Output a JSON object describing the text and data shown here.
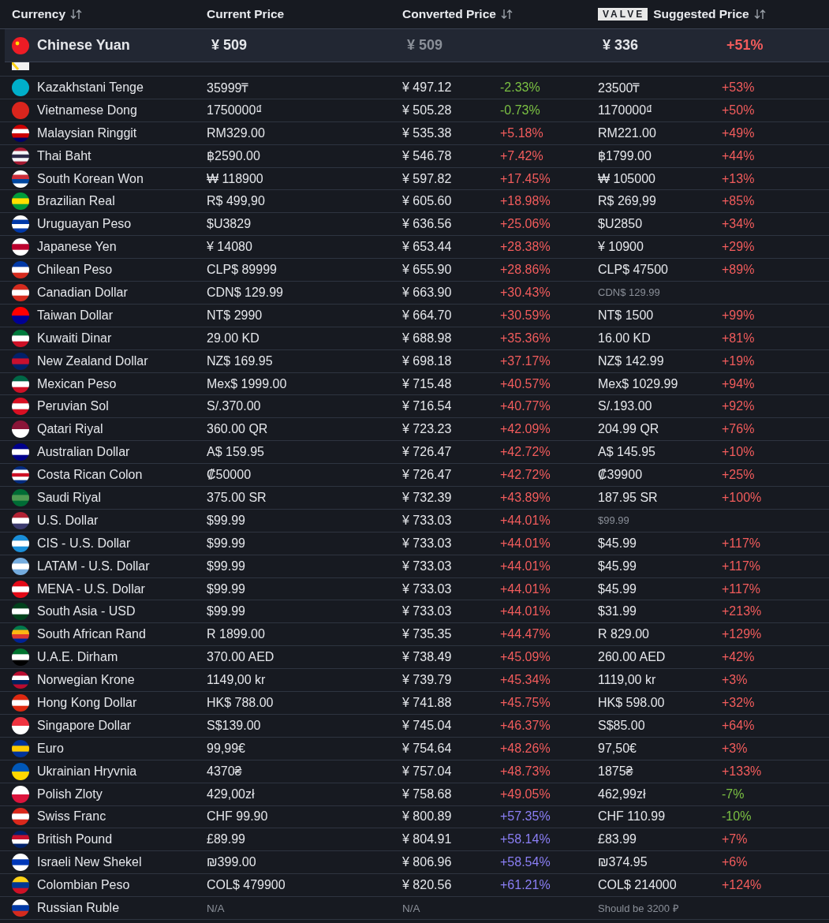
{
  "columns": [
    {
      "label": "Currency",
      "sortable": true
    },
    {
      "label": "Current Price",
      "sortable": false
    },
    {
      "label": "Converted Price",
      "sortable": true
    },
    {
      "label": "Suggested Price",
      "sortable": true,
      "badge": "VALVE"
    }
  ],
  "pinned": {
    "currency": "Chinese Yuan",
    "current": "¥ 509",
    "converted": "¥ 509",
    "suggested": "¥ 336",
    "sdiff": {
      "text": "+51%",
      "color": "#f25c5c"
    }
  },
  "rows": [
    {
      "currency": "Kazakhstani Tenge",
      "current": "35999₸",
      "converted": "¥ 497.12",
      "diff": {
        "text": "-2.33%",
        "color": "#7bc043"
      },
      "suggested": "23500₸",
      "sdiff": {
        "text": "+53%",
        "color": "#f25c5c"
      },
      "unavailable": false,
      "suggested_muted": false
    },
    {
      "currency": "Vietnamese Dong",
      "current": "1750000₫",
      "converted": "¥ 505.28",
      "diff": {
        "text": "-0.73%",
        "color": "#7bc043"
      },
      "suggested": "1170000₫",
      "sdiff": {
        "text": "+50%",
        "color": "#f25c5c"
      },
      "unavailable": false,
      "suggested_muted": false
    },
    {
      "currency": "Malaysian Ringgit",
      "current": "RM329.00",
      "converted": "¥ 535.38",
      "diff": {
        "text": "+5.18%",
        "color": "#f25c5c"
      },
      "suggested": "RM221.00",
      "sdiff": {
        "text": "+49%",
        "color": "#f25c5c"
      },
      "unavailable": false,
      "suggested_muted": false
    },
    {
      "currency": "Thai Baht",
      "current": "฿2590.00",
      "converted": "¥ 546.78",
      "diff": {
        "text": "+7.42%",
        "color": "#f25c5c"
      },
      "suggested": "฿1799.00",
      "sdiff": {
        "text": "+44%",
        "color": "#f25c5c"
      },
      "unavailable": false,
      "suggested_muted": false
    },
    {
      "currency": "South Korean Won",
      "current": "₩ 118900",
      "converted": "¥ 597.82",
      "diff": {
        "text": "+17.45%",
        "color": "#f25c5c"
      },
      "suggested": "₩ 105000",
      "sdiff": {
        "text": "+13%",
        "color": "#f25c5c"
      },
      "unavailable": false,
      "suggested_muted": false
    },
    {
      "currency": "Brazilian Real",
      "current": "R$ 499,90",
      "converted": "¥ 605.60",
      "diff": {
        "text": "+18.98%",
        "color": "#f25c5c"
      },
      "suggested": "R$ 269,99",
      "sdiff": {
        "text": "+85%",
        "color": "#f25c5c"
      },
      "unavailable": false,
      "suggested_muted": false
    },
    {
      "currency": "Uruguayan Peso",
      "current": "$U3829",
      "converted": "¥ 636.56",
      "diff": {
        "text": "+25.06%",
        "color": "#f25c5c"
      },
      "suggested": "$U2850",
      "sdiff": {
        "text": "+34%",
        "color": "#f25c5c"
      },
      "unavailable": false,
      "suggested_muted": false
    },
    {
      "currency": "Japanese Yen",
      "current": "¥ 14080",
      "converted": "¥ 653.44",
      "diff": {
        "text": "+28.38%",
        "color": "#f25c5c"
      },
      "suggested": "¥ 10900",
      "sdiff": {
        "text": "+29%",
        "color": "#f25c5c"
      },
      "unavailable": false,
      "suggested_muted": false
    },
    {
      "currency": "Chilean Peso",
      "current": "CLP$ 89999",
      "converted": "¥ 655.90",
      "diff": {
        "text": "+28.86%",
        "color": "#f25c5c"
      },
      "suggested": "CLP$ 47500",
      "sdiff": {
        "text": "+89%",
        "color": "#f25c5c"
      },
      "unavailable": false,
      "suggested_muted": false
    },
    {
      "currency": "Canadian Dollar",
      "current": "CDN$ 129.99",
      "converted": "¥ 663.90",
      "diff": {
        "text": "+30.43%",
        "color": "#f25c5c"
      },
      "suggested": "CDN$ 129.99",
      "unavailable": false,
      "suggested_muted": true
    },
    {
      "currency": "Taiwan Dollar",
      "current": "NT$ 2990",
      "converted": "¥ 664.70",
      "diff": {
        "text": "+30.59%",
        "color": "#f25c5c"
      },
      "suggested": "NT$ 1500",
      "sdiff": {
        "text": "+99%",
        "color": "#f25c5c"
      },
      "unavailable": false,
      "suggested_muted": false
    },
    {
      "currency": "Kuwaiti Dinar",
      "current": "29.00 KD",
      "converted": "¥ 688.98",
      "diff": {
        "text": "+35.36%",
        "color": "#f25c5c"
      },
      "suggested": "16.00 KD",
      "sdiff": {
        "text": "+81%",
        "color": "#f25c5c"
      },
      "unavailable": false,
      "suggested_muted": false
    },
    {
      "currency": "New Zealand Dollar",
      "current": "NZ$ 169.95",
      "converted": "¥ 698.18",
      "diff": {
        "text": "+37.17%",
        "color": "#f25c5c"
      },
      "suggested": "NZ$ 142.99",
      "sdiff": {
        "text": "+19%",
        "color": "#f25c5c"
      },
      "unavailable": false,
      "suggested_muted": false
    },
    {
      "currency": "Mexican Peso",
      "current": "Mex$ 1999.00",
      "converted": "¥ 715.48",
      "diff": {
        "text": "+40.57%",
        "color": "#f25c5c"
      },
      "suggested": "Mex$ 1029.99",
      "sdiff": {
        "text": "+94%",
        "color": "#f25c5c"
      },
      "unavailable": false,
      "suggested_muted": false
    },
    {
      "currency": "Peruvian Sol",
      "current": "S/.370.00",
      "converted": "¥ 716.54",
      "diff": {
        "text": "+40.77%",
        "color": "#f25c5c"
      },
      "suggested": "S/.193.00",
      "sdiff": {
        "text": "+92%",
        "color": "#f25c5c"
      },
      "unavailable": false,
      "suggested_muted": false
    },
    {
      "currency": "Qatari Riyal",
      "current": "360.00 QR",
      "converted": "¥ 723.23",
      "diff": {
        "text": "+42.09%",
        "color": "#f25c5c"
      },
      "suggested": "204.99 QR",
      "sdiff": {
        "text": "+76%",
        "color": "#f25c5c"
      },
      "unavailable": false,
      "suggested_muted": false
    },
    {
      "currency": "Australian Dollar",
      "current": "A$ 159.95",
      "converted": "¥ 726.47",
      "diff": {
        "text": "+42.72%",
        "color": "#f25c5c"
      },
      "suggested": "A$ 145.95",
      "sdiff": {
        "text": "+10%",
        "color": "#f25c5c"
      },
      "unavailable": false,
      "suggested_muted": false
    },
    {
      "currency": "Costa Rican Colon",
      "current": "₡50000",
      "converted": "¥ 726.47",
      "diff": {
        "text": "+42.72%",
        "color": "#f25c5c"
      },
      "suggested": "₡39900",
      "sdiff": {
        "text": "+25%",
        "color": "#f25c5c"
      },
      "unavailable": false,
      "suggested_muted": false
    },
    {
      "currency": "Saudi Riyal",
      "current": "375.00 SR",
      "converted": "¥ 732.39",
      "diff": {
        "text": "+43.89%",
        "color": "#f25c5c"
      },
      "suggested": "187.95 SR",
      "sdiff": {
        "text": "+100%",
        "color": "#f25c5c"
      },
      "unavailable": false,
      "suggested_muted": false
    },
    {
      "currency": "U.S. Dollar",
      "current": "$99.99",
      "converted": "¥ 733.03",
      "diff": {
        "text": "+44.01%",
        "color": "#f25c5c"
      },
      "suggested": "$99.99",
      "unavailable": false,
      "suggested_muted": true
    },
    {
      "currency": "CIS - U.S. Dollar",
      "current": "$99.99",
      "converted": "¥ 733.03",
      "diff": {
        "text": "+44.01%",
        "color": "#f25c5c"
      },
      "suggested": "$45.99",
      "sdiff": {
        "text": "+117%",
        "color": "#f25c5c"
      },
      "unavailable": false,
      "suggested_muted": false
    },
    {
      "currency": "LATAM - U.S. Dollar",
      "current": "$99.99",
      "converted": "¥ 733.03",
      "diff": {
        "text": "+44.01%",
        "color": "#f25c5c"
      },
      "suggested": "$45.99",
      "sdiff": {
        "text": "+117%",
        "color": "#f25c5c"
      },
      "unavailable": false,
      "suggested_muted": false
    },
    {
      "currency": "MENA - U.S. Dollar",
      "current": "$99.99",
      "converted": "¥ 733.03",
      "diff": {
        "text": "+44.01%",
        "color": "#f25c5c"
      },
      "suggested": "$45.99",
      "sdiff": {
        "text": "+117%",
        "color": "#f25c5c"
      },
      "unavailable": false,
      "suggested_muted": false
    },
    {
      "currency": "South Asia - USD",
      "current": "$99.99",
      "converted": "¥ 733.03",
      "diff": {
        "text": "+44.01%",
        "color": "#f25c5c"
      },
      "suggested": "$31.99",
      "sdiff": {
        "text": "+213%",
        "color": "#f25c5c"
      },
      "unavailable": false,
      "suggested_muted": false
    },
    {
      "currency": "South African Rand",
      "current": "R 1899.00",
      "converted": "¥ 735.35",
      "diff": {
        "text": "+44.47%",
        "color": "#f25c5c"
      },
      "suggested": "R 829.00",
      "sdiff": {
        "text": "+129%",
        "color": "#f25c5c"
      },
      "unavailable": false,
      "suggested_muted": false
    },
    {
      "currency": "U.A.E. Dirham",
      "current": "370.00 AED",
      "converted": "¥ 738.49",
      "diff": {
        "text": "+45.09%",
        "color": "#f25c5c"
      },
      "suggested": "260.00 AED",
      "sdiff": {
        "text": "+42%",
        "color": "#f25c5c"
      },
      "unavailable": false,
      "suggested_muted": false
    },
    {
      "currency": "Norwegian Krone",
      "current": "1149,00 kr",
      "converted": "¥ 739.79",
      "diff": {
        "text": "+45.34%",
        "color": "#f25c5c"
      },
      "suggested": "1119,00 kr",
      "sdiff": {
        "text": "+3%",
        "color": "#f25c5c"
      },
      "unavailable": false,
      "suggested_muted": false
    },
    {
      "currency": "Hong Kong Dollar",
      "current": "HK$ 788.00",
      "converted": "¥ 741.88",
      "diff": {
        "text": "+45.75%",
        "color": "#f25c5c"
      },
      "suggested": "HK$ 598.00",
      "sdiff": {
        "text": "+32%",
        "color": "#f25c5c"
      },
      "unavailable": false,
      "suggested_muted": false
    },
    {
      "currency": "Singapore Dollar",
      "current": "S$139.00",
      "converted": "¥ 745.04",
      "diff": {
        "text": "+46.37%",
        "color": "#f25c5c"
      },
      "suggested": "S$85.00",
      "sdiff": {
        "text": "+64%",
        "color": "#f25c5c"
      },
      "unavailable": false,
      "suggested_muted": false
    },
    {
      "currency": "Euro",
      "current": "99,99€",
      "converted": "¥ 754.64",
      "diff": {
        "text": "+48.26%",
        "color": "#f25c5c"
      },
      "suggested": "97,50€",
      "sdiff": {
        "text": "+3%",
        "color": "#f25c5c"
      },
      "unavailable": false,
      "suggested_muted": false
    },
    {
      "currency": "Ukrainian Hryvnia",
      "current": "4370₴",
      "converted": "¥ 757.04",
      "diff": {
        "text": "+48.73%",
        "color": "#f25c5c"
      },
      "suggested": "1875₴",
      "sdiff": {
        "text": "+133%",
        "color": "#f25c5c"
      },
      "unavailable": false,
      "suggested_muted": false
    },
    {
      "currency": "Polish Zloty",
      "current": "429,00zł",
      "converted": "¥ 758.68",
      "diff": {
        "text": "+49.05%",
        "color": "#f25c5c"
      },
      "suggested": "462,99zł",
      "sdiff": {
        "text": "-7%",
        "color": "#7bc043"
      },
      "unavailable": false,
      "suggested_muted": false
    },
    {
      "currency": "Swiss Franc",
      "current": "CHF 99.90",
      "converted": "¥ 800.89",
      "diff": {
        "text": "+57.35%",
        "color": "#8b7ff5"
      },
      "suggested": "CHF 110.99",
      "sdiff": {
        "text": "-10%",
        "color": "#7bc043"
      },
      "unavailable": false,
      "suggested_muted": false
    },
    {
      "currency": "British Pound",
      "current": "£89.99",
      "converted": "¥ 804.91",
      "diff": {
        "text": "+58.14%",
        "color": "#8b7ff5"
      },
      "suggested": "£83.99",
      "sdiff": {
        "text": "+7%",
        "color": "#f25c5c"
      },
      "unavailable": false,
      "suggested_muted": false
    },
    {
      "currency": "Israeli New Shekel",
      "current": "₪399.00",
      "converted": "¥ 806.96",
      "diff": {
        "text": "+58.54%",
        "color": "#8b7ff5"
      },
      "suggested": "₪374.95",
      "sdiff": {
        "text": "+6%",
        "color": "#f25c5c"
      },
      "unavailable": false,
      "suggested_muted": false
    },
    {
      "currency": "Colombian Peso",
      "current": "COL$ 479900",
      "converted": "¥ 820.56",
      "diff": {
        "text": "+61.21%",
        "color": "#8b7ff5"
      },
      "suggested": "COL$ 214000",
      "sdiff": {
        "text": "+124%",
        "color": "#f25c5c"
      },
      "unavailable": false,
      "suggested_muted": false
    },
    {
      "currency": "Russian Ruble",
      "current": "N/A",
      "converted": "N/A",
      "suggested": "Should be 3200 ₽",
      "unavailable": true,
      "suggested_muted": true
    }
  ]
}
